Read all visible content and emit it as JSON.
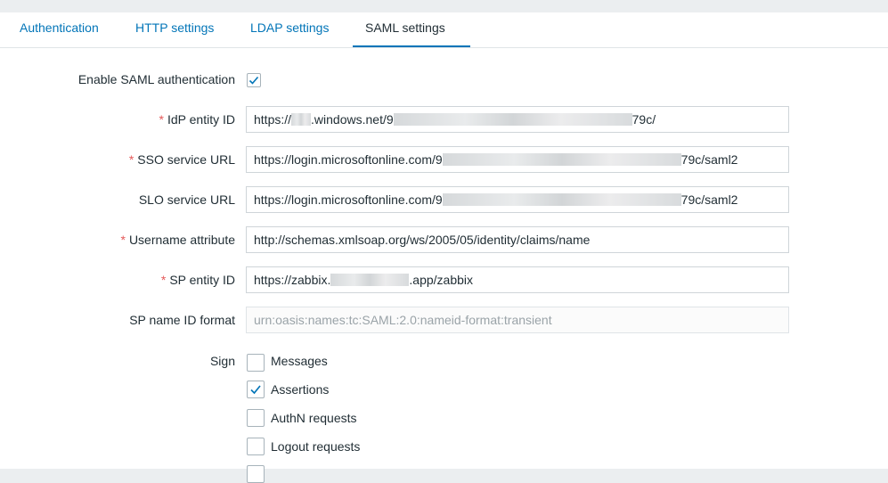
{
  "tabs": [
    {
      "label": "Authentication"
    },
    {
      "label": "HTTP settings"
    },
    {
      "label": "LDAP settings"
    },
    {
      "label": "SAML settings",
      "active": true
    }
  ],
  "form": {
    "enable_saml": {
      "label": "Enable SAML authentication",
      "checked": true
    },
    "idp_entity_id": {
      "label": "IdP entity ID",
      "required": "*",
      "value_prefix": "https://",
      "value_mid": ".windows.net/9",
      "value_suffix": "79c/"
    },
    "sso_service_url": {
      "label": "SSO service URL",
      "required": "*",
      "value_prefix": "https://login.microsoftonline.com/9",
      "value_suffix": "79c/saml2"
    },
    "slo_service_url": {
      "label": "SLO service URL",
      "value_prefix": "https://login.microsoftonline.com/9",
      "value_suffix": "79c/saml2"
    },
    "username_attribute": {
      "label": "Username attribute",
      "required": "*",
      "value": "http://schemas.xmlsoap.org/ws/2005/05/identity/claims/name"
    },
    "sp_entity_id": {
      "label": "SP entity ID",
      "required": "*",
      "value_prefix": "https://zabbix.",
      "value_suffix": ".app/zabbix"
    },
    "sp_name_id_format": {
      "label": "SP name ID format",
      "placeholder": "urn:oasis:names:tc:SAML:2.0:nameid-format:transient"
    },
    "sign": {
      "label": "Sign",
      "options": [
        {
          "label": "Messages",
          "checked": false
        },
        {
          "label": "Assertions",
          "checked": true
        },
        {
          "label": "AuthN requests",
          "checked": false
        },
        {
          "label": "Logout requests",
          "checked": false
        }
      ]
    }
  },
  "colors": {
    "accent": "#0275b8",
    "required": "#e45959",
    "text": "#1f2c33"
  }
}
